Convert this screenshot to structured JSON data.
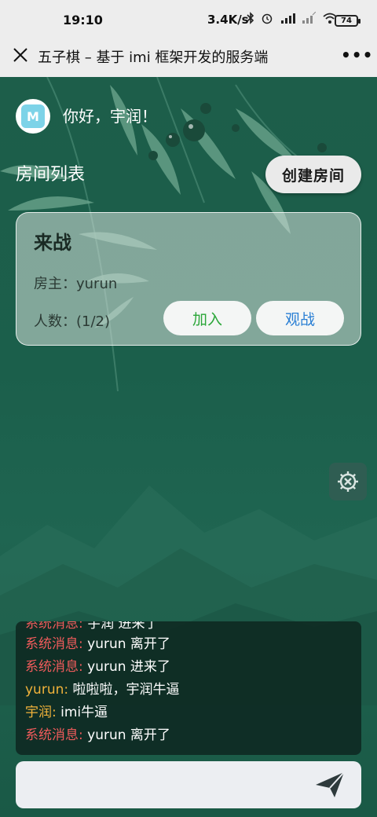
{
  "status": {
    "time": "19:10",
    "speed": "3.4K/s",
    "battery": "74"
  },
  "nav": {
    "title": "五子棋 – 基于 imi 框架开发的服务端",
    "more": "•••"
  },
  "user": {
    "avatar_glyph": "M",
    "greeting": "你好，宇润！"
  },
  "rooms": {
    "title": "房间列表",
    "create_label": "创建房间",
    "items": [
      {
        "name": "来战",
        "owner": "房主：yurun",
        "count": "人数：(1/2)",
        "join_label": "加入",
        "watch_label": "观战"
      }
    ]
  },
  "chat": {
    "messages": [
      {
        "who": "系统消息:",
        "text": " 宇润 进来了",
        "kind": "sys"
      },
      {
        "who": "系统消息:",
        "text": " yurun 离开了",
        "kind": "sys"
      },
      {
        "who": "系统消息:",
        "text": " yurun 进来了",
        "kind": "sys"
      },
      {
        "who": "yurun:",
        "text": " 啦啦啦，宇润牛逼",
        "kind": "user"
      },
      {
        "who": "宇润:",
        "text": " imi牛逼",
        "kind": "user"
      },
      {
        "who": "系统消息:",
        "text": " yurun 离开了",
        "kind": "sys"
      }
    ]
  },
  "input": {
    "value": "",
    "placeholder": ""
  },
  "colors": {
    "background": "#1d5e4a",
    "system_sender": "#ef5b5b",
    "user_sender": "#f0b23a",
    "join": "#2aa638",
    "watch": "#2a7fd4"
  }
}
